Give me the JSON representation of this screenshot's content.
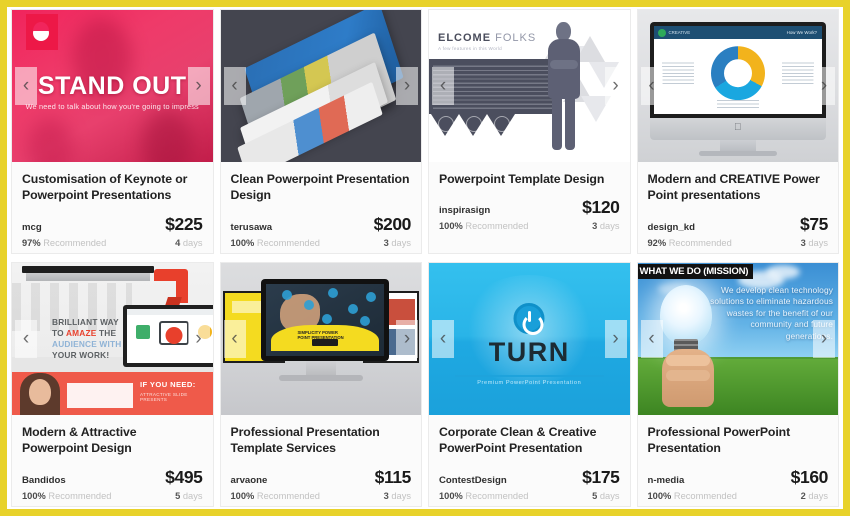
{
  "page": {
    "accent_border_color": "#e8d22a",
    "card_bg": "#fbfbfb"
  },
  "carousel": {
    "prev_label": "‹",
    "next_label": "›"
  },
  "labels": {
    "recommended": "Recommended",
    "days_suffix": "days"
  },
  "cards": [
    {
      "title": "Customisation of Keynote or Powerpoint Presentations",
      "seller": "mcg",
      "price": "$225",
      "recommended_pct": "97%",
      "delivery_days": "4",
      "thumb": {
        "style": "stand-out-pink",
        "headline": "STAND OUT",
        "subline": "We need to talk about how you're going to impress"
      }
    },
    {
      "title": "Clean Powerpoint Presentation Design",
      "seller": "terusawa",
      "price": "$200",
      "recommended_pct": "100%",
      "delivery_days": "3",
      "thumb": {
        "style": "stacked-slides-dark"
      }
    },
    {
      "title": "Powerpoint Template Design",
      "seller": "inspirasign",
      "price": "$120",
      "recommended_pct": "100%",
      "delivery_days": "3",
      "thumb": {
        "style": "elcome-folks",
        "headline_bold": "ELCOME",
        "headline_light": "FOLKS",
        "subline": "A few features in this World"
      }
    },
    {
      "title": "Modern and CREATIVE Power Point presentations",
      "seller": "design_kd",
      "price": "$75",
      "recommended_pct": "92%",
      "delivery_days": "3",
      "thumb": {
        "style": "imac-pie-chart",
        "nav_brand": "CREATIVE",
        "nav_right": "How We Work?"
      }
    },
    {
      "title": "Modern & Attractive Powerpoint Design",
      "seller": "Bandidos",
      "price": "$495",
      "recommended_pct": "100%",
      "delivery_days": "5",
      "thumb": {
        "style": "brilliant-way-red",
        "line1": "BRILLIANT WAY",
        "line2_pre": "TO ",
        "line2_hl": "AMAZE",
        "line2_post": " THE",
        "line3": "AUDIENCE WITH",
        "line4": "YOUR WORK!",
        "banner": "IF YOU NEED:",
        "banner_sub": "ATTRACTIVE SLIDE PRESENTS"
      }
    },
    {
      "title": "Professional Presentation Template Services",
      "seller": "arvaone",
      "price": "$115",
      "recommended_pct": "100%",
      "delivery_days": "3",
      "thumb": {
        "style": "monitors-yellow",
        "caption": "SIMPLICITY POWER POINT PRESENTATION",
        "button": "LEARN"
      }
    },
    {
      "title": "Corporate Clean & Creative PowerPoint Presentation",
      "seller": "ContestDesign",
      "price": "$175",
      "recommended_pct": "100%",
      "delivery_days": "5",
      "thumb": {
        "style": "turn-cyan",
        "headline": "TURN",
        "subline": "Premium PowerPoint Presentation"
      }
    },
    {
      "title": "Professional PowerPoint Presentation",
      "seller": "n-media",
      "price": "$160",
      "recommended_pct": "100%",
      "delivery_days": "2",
      "thumb": {
        "style": "lightbulb-mission",
        "header": "WHAT WE DO (MISSION)",
        "body": "We develop clean technology solutions to eliminate hazardous wastes for the benefit of our community and future generations."
      }
    }
  ]
}
